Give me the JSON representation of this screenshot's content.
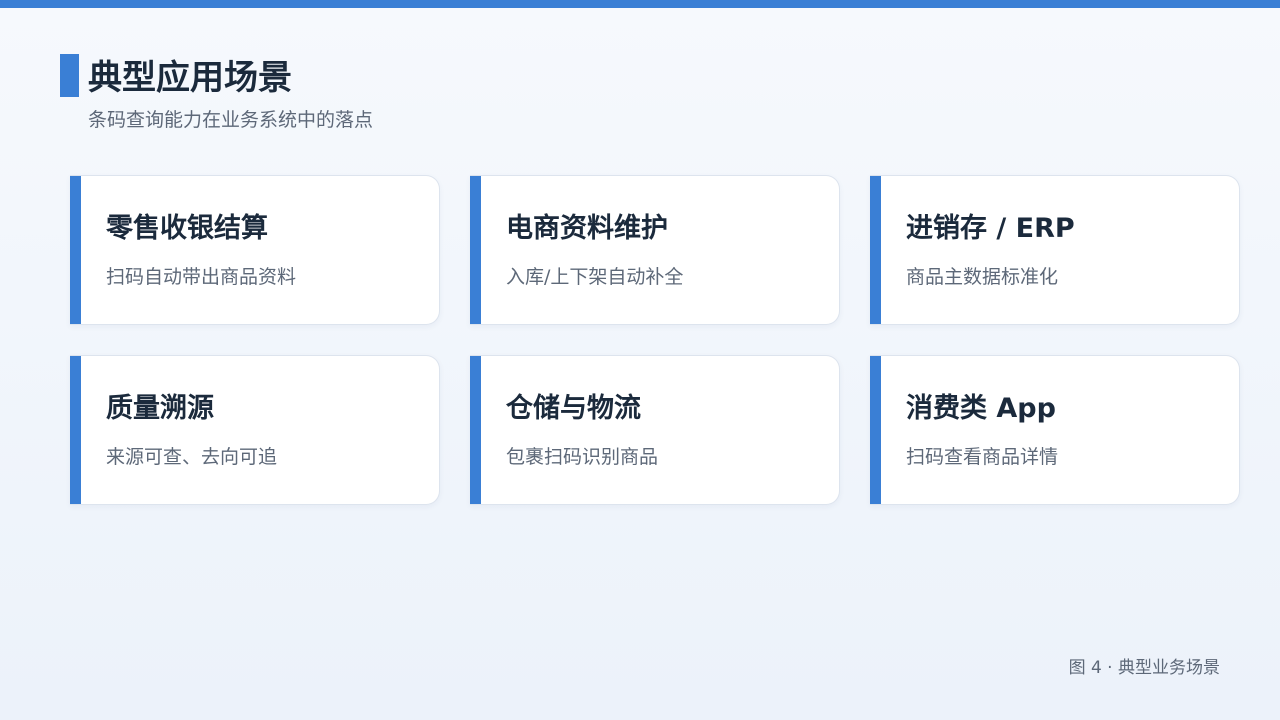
{
  "header": {
    "title": "典型应用场景",
    "subtitle": "条码查询能力在业务系统中的落点"
  },
  "cards": [
    {
      "title": "零售收银结算",
      "desc": "扫码自动带出商品资料"
    },
    {
      "title": "电商资料维护",
      "desc": "入库/上下架自动补全"
    },
    {
      "title": "进销存 / ERP",
      "desc": "商品主数据标准化"
    },
    {
      "title": "质量溯源",
      "desc": "来源可查、去向可追"
    },
    {
      "title": "仓储与物流",
      "desc": "包裹扫码识别商品"
    },
    {
      "title": "消费类 App",
      "desc": "扫码查看商品详情"
    }
  ],
  "caption": "图 4 · 典型业务场景",
  "colors": {
    "accent": "#3a7fd5",
    "title_text": "#1b2a3c",
    "body_text": "#5d6878",
    "card_background": "#ffffff"
  }
}
